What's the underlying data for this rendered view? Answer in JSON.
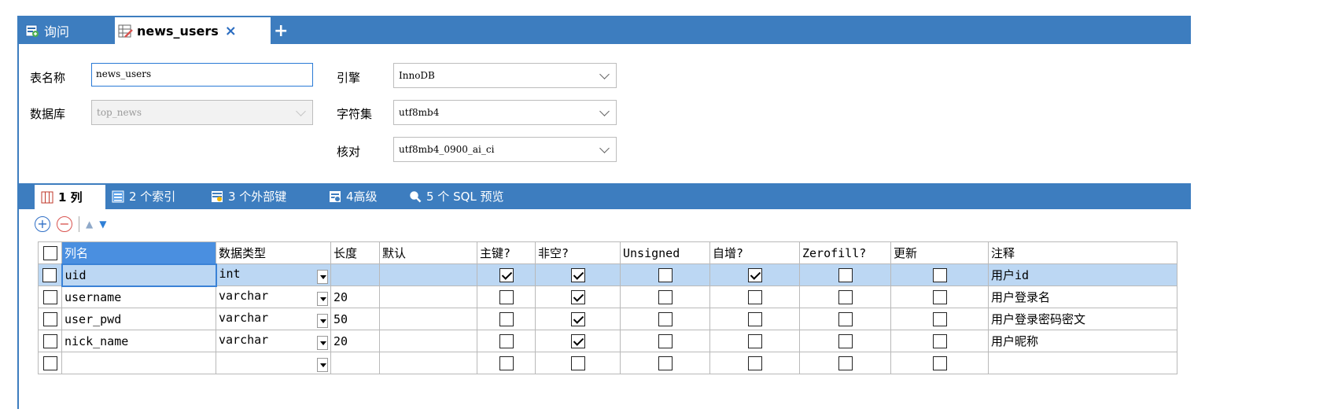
{
  "tabs": {
    "query_label": "询问",
    "table_label": "news_users",
    "add_label": "+",
    "close_label": "×"
  },
  "form": {
    "table_name_label": "表名称",
    "table_name_value": "news_users",
    "database_label": "数据库",
    "database_value": "top_news",
    "engine_label": "引擎",
    "engine_value": "InnoDB",
    "charset_label": "字符集",
    "charset_value": "utf8mb4",
    "collation_label": "核对",
    "collation_value": "utf8mb4_0900_ai_ci"
  },
  "subtabs": {
    "columns": "1 列",
    "indexes": "2 个索引",
    "foreign_keys": "3 个外部键",
    "advanced": "4高级",
    "sql_preview": "5 个 SQL 预览"
  },
  "grid": {
    "headers": {
      "name": "列名",
      "type": "数据类型",
      "length": "长度",
      "default": "默认",
      "pk": "主键?",
      "not_null": "非空?",
      "unsigned": "Unsigned",
      "auto_inc": "自增?",
      "zerofill": "Zerofill?",
      "update": "更新",
      "comment": "注释"
    },
    "rows": [
      {
        "name": "uid",
        "type": "int",
        "length": "",
        "default": "",
        "pk": true,
        "not_null": true,
        "unsigned": false,
        "auto_inc": true,
        "zerofill": false,
        "update": false,
        "comment": "用户id"
      },
      {
        "name": "username",
        "type": "varchar",
        "length": "20",
        "default": "",
        "pk": false,
        "not_null": true,
        "unsigned": false,
        "auto_inc": false,
        "zerofill": false,
        "update": false,
        "comment": "用户登录名"
      },
      {
        "name": "user_pwd",
        "type": "varchar",
        "length": "50",
        "default": "",
        "pk": false,
        "not_null": true,
        "unsigned": false,
        "auto_inc": false,
        "zerofill": false,
        "update": false,
        "comment": "用户登录密码密文"
      },
      {
        "name": "nick_name",
        "type": "varchar",
        "length": "20",
        "default": "",
        "pk": false,
        "not_null": true,
        "unsigned": false,
        "auto_inc": false,
        "zerofill": false,
        "update": false,
        "comment": "用户昵称"
      },
      {
        "name": "",
        "type": "",
        "length": "",
        "default": "",
        "pk": false,
        "not_null": false,
        "unsigned": false,
        "auto_inc": false,
        "zerofill": false,
        "update": false,
        "comment": ""
      }
    ]
  },
  "colors": {
    "accent": "#3d7dbf",
    "selected_row": "#bcd7f3",
    "header_highlight": "#4a8fe0"
  }
}
